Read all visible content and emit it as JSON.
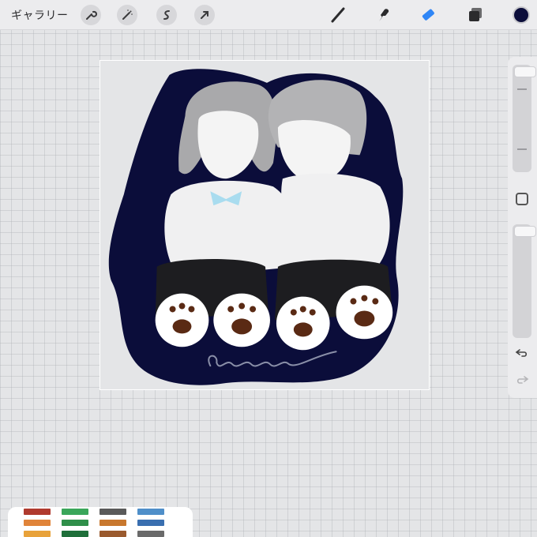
{
  "toolbar": {
    "gallery_label": "ギャラリー",
    "left_tools": [
      "wrench-icon",
      "magic-wand-icon",
      "selection-icon",
      "transform-arrow-icon"
    ],
    "right_tools": [
      "brush-icon",
      "smudge-icon",
      "eraser-icon",
      "layers-icon"
    ],
    "current_color": "#0b0d3a",
    "active_tool": "eraser-icon",
    "active_color": "#2f86f6"
  },
  "sidebar": {
    "brush_size": 1.0,
    "opacity": 1.0,
    "undo_icon": "undo-icon",
    "redo_icon": "redo-icon"
  },
  "canvas": {
    "background_color": "#0b0d3a",
    "signature_color": "#8a8fa8"
  },
  "reference_panel": {
    "swatch_colors": [
      [
        "#b03a2e",
        "#3aa65a",
        "#5a5a5a",
        "#4f8fc9"
      ],
      [
        "#e0843a",
        "#2f8f4a",
        "#c8782e",
        "#3a6fb0"
      ],
      [
        "#e8a23a",
        "#1f6f3a",
        "#9a5a2e",
        "#6a6a6a"
      ]
    ]
  }
}
